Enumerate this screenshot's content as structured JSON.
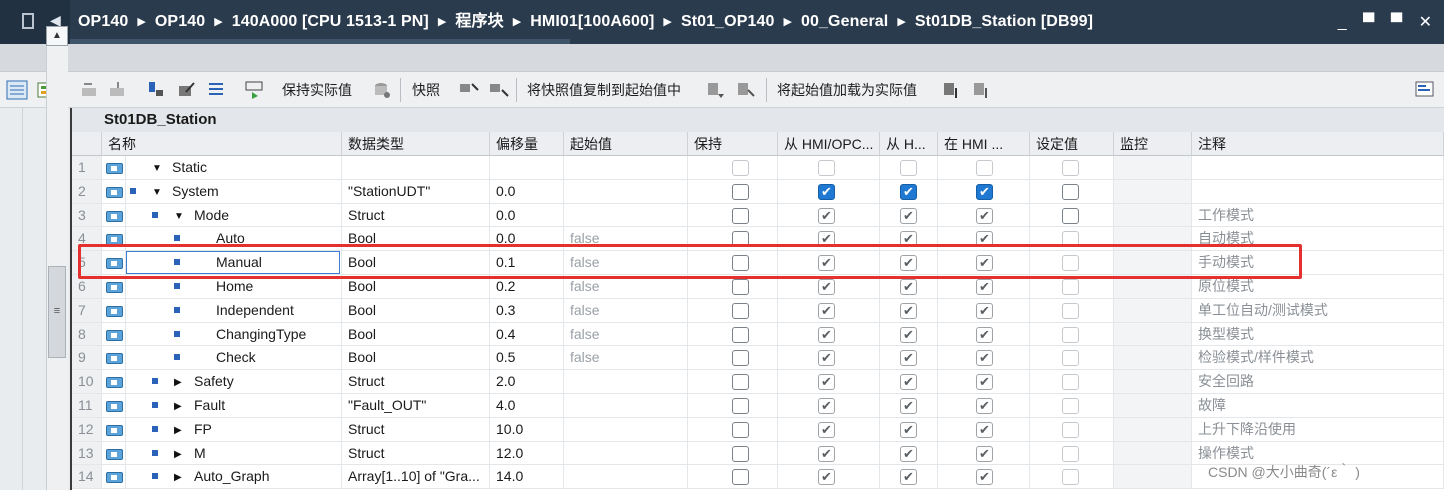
{
  "breadcrumb": [
    "OP140",
    "OP140",
    "140A000 [CPU 1513-1 PN]",
    "程序块",
    "HMI01[100A600]",
    "St01_OP140",
    "00_General",
    "St01DB_Station [DB99]"
  ],
  "window_controls": "_ ▀ ▀ ✕",
  "toolbar": {
    "keep_actual": "保持实际值",
    "snapshot": "快照",
    "copy_snapshot": "将快照值复制到起始值中",
    "load_start": "将起始值加载为实际值"
  },
  "block_title": "St01DB_Station",
  "columns": [
    "名称",
    "数据类型",
    "偏移量",
    "起始值",
    "保持",
    "从 HMI/OPC...",
    "从 H...",
    "在 HMI ...",
    "设定值",
    "监控",
    "注释"
  ],
  "rows": [
    {
      "num": "1",
      "indent": 0,
      "expander": "▼",
      "marker": false,
      "name": "Static",
      "type": "",
      "offset": "",
      "start": "",
      "c": [
        "light",
        "light",
        "light",
        "light",
        "light"
      ],
      "comment": ""
    },
    {
      "num": "2",
      "indent": 0,
      "expander": "▼",
      "marker": true,
      "name": "System",
      "type": "\"StationUDT\"",
      "offset": "0.0",
      "start": "",
      "c": [
        "empty",
        "blue",
        "blue",
        "blue",
        "empty"
      ],
      "comment": ""
    },
    {
      "num": "3",
      "indent": 1,
      "expander": "▼",
      "marker": true,
      "name": "Mode",
      "type": "Struct",
      "offset": "0.0",
      "start": "",
      "c": [
        "empty",
        "grey",
        "grey",
        "grey",
        "empty"
      ],
      "comment": "工作模式"
    },
    {
      "num": "4",
      "indent": 2,
      "expander": "",
      "marker": true,
      "name": "Auto",
      "type": "Bool",
      "offset": "0.0",
      "start": "false",
      "c": [
        "empty",
        "grey",
        "grey",
        "grey",
        "light"
      ],
      "comment": "自动模式"
    },
    {
      "num": "5",
      "indent": 2,
      "expander": "",
      "marker": true,
      "name": "Manual",
      "type": "Bool",
      "offset": "0.1",
      "start": "false",
      "c": [
        "empty",
        "grey",
        "grey",
        "grey",
        "light"
      ],
      "comment": "手动模式"
    },
    {
      "num": "6",
      "indent": 2,
      "expander": "",
      "marker": true,
      "name": "Home",
      "type": "Bool",
      "offset": "0.2",
      "start": "false",
      "c": [
        "empty",
        "grey",
        "grey",
        "grey",
        "light"
      ],
      "comment": "原位模式"
    },
    {
      "num": "7",
      "indent": 2,
      "expander": "",
      "marker": true,
      "name": "Independent",
      "type": "Bool",
      "offset": "0.3",
      "start": "false",
      "c": [
        "empty",
        "grey",
        "grey",
        "grey",
        "light"
      ],
      "comment": "单工位自动/测试模式"
    },
    {
      "num": "8",
      "indent": 2,
      "expander": "",
      "marker": true,
      "name": "ChangingType",
      "type": "Bool",
      "offset": "0.4",
      "start": "false",
      "c": [
        "empty",
        "grey",
        "grey",
        "grey",
        "light"
      ],
      "comment": "换型模式"
    },
    {
      "num": "9",
      "indent": 2,
      "expander": "",
      "marker": true,
      "name": "Check",
      "type": "Bool",
      "offset": "0.5",
      "start": "false",
      "c": [
        "empty",
        "grey",
        "grey",
        "grey",
        "light"
      ],
      "comment": "检验模式/样件模式"
    },
    {
      "num": "10",
      "indent": 1,
      "expander": "▶",
      "marker": true,
      "name": "Safety",
      "type": "Struct",
      "offset": "2.0",
      "start": "",
      "c": [
        "empty",
        "grey",
        "grey",
        "grey",
        "light"
      ],
      "comment": "安全回路"
    },
    {
      "num": "11",
      "indent": 1,
      "expander": "▶",
      "marker": true,
      "name": "Fault",
      "type": "\"Fault_OUT\"",
      "offset": "4.0",
      "start": "",
      "c": [
        "empty",
        "grey",
        "grey",
        "grey",
        "light"
      ],
      "comment": "故障"
    },
    {
      "num": "12",
      "indent": 1,
      "expander": "▶",
      "marker": true,
      "name": "FP",
      "type": "Struct",
      "offset": "10.0",
      "start": "",
      "c": [
        "empty",
        "grey",
        "grey",
        "grey",
        "light"
      ],
      "comment": "上升下降沿使用"
    },
    {
      "num": "13",
      "indent": 1,
      "expander": "▶",
      "marker": true,
      "name": "M",
      "type": "Struct",
      "offset": "12.0",
      "start": "",
      "c": [
        "empty",
        "grey",
        "grey",
        "grey",
        "light"
      ],
      "comment": "操作模式"
    },
    {
      "num": "14",
      "indent": 1,
      "expander": "▶",
      "marker": true,
      "name": "Auto_Graph",
      "type": "Array[1..10] of \"Gra...",
      "offset": "14.0",
      "start": "",
      "c": [
        "empty",
        "grey",
        "grey",
        "grey",
        "light"
      ],
      "comment": ""
    }
  ],
  "watermark": "CSDN @大小曲奇(´ε｀ )",
  "colors": {
    "titlebar": "#2a3b4d",
    "highlight": "#e53030",
    "checkbox_blue": "#1f78d1"
  }
}
